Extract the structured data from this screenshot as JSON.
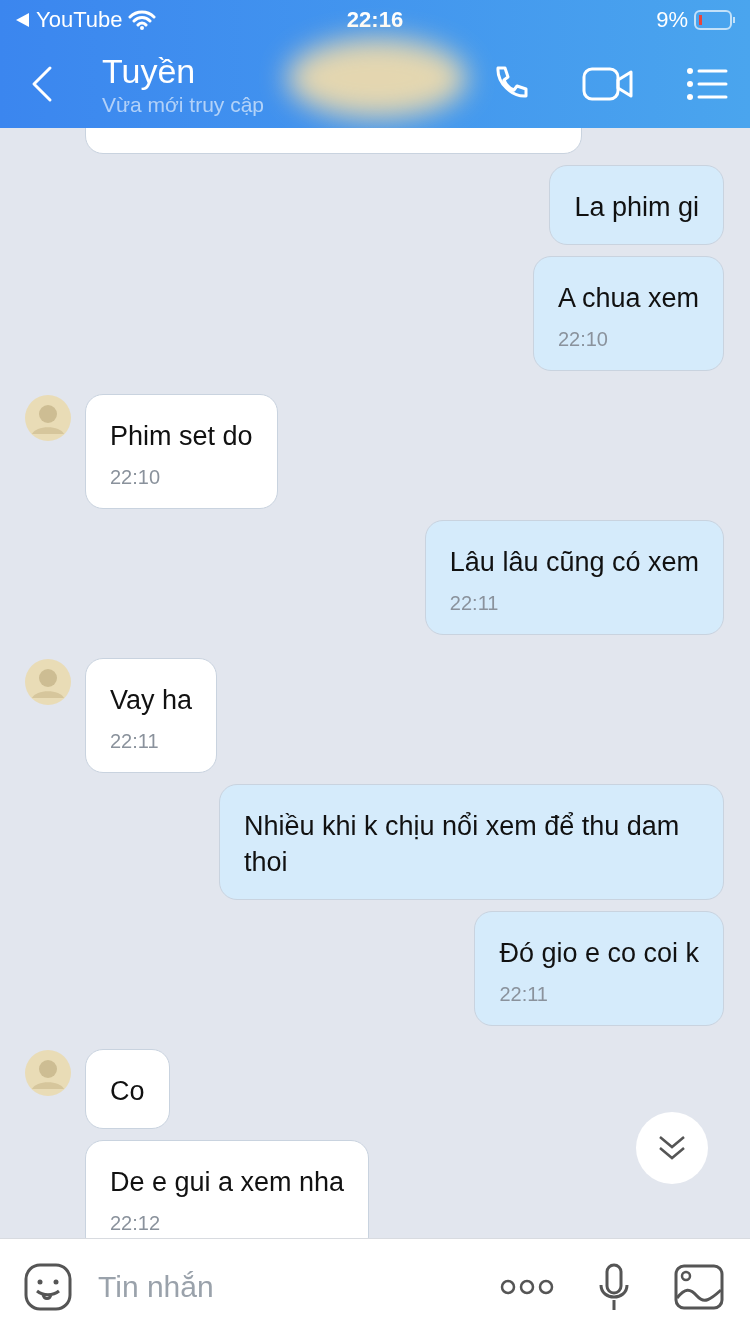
{
  "status_bar": {
    "app_back": "YouTube",
    "time": "22:16",
    "battery": "9%"
  },
  "header": {
    "name": "Tuyền",
    "subtitle": "Vừa mới truy cập"
  },
  "messages": [
    {
      "kind": "incoming"
    },
    {
      "kind": "outgoing",
      "text": "La phim gi"
    },
    {
      "kind": "outgoing",
      "text": "A chua xem",
      "time": "22:10"
    },
    {
      "kind": "incoming",
      "text": "Phim set do",
      "time": "22:10",
      "show_avatar": true
    },
    {
      "kind": "outgoing",
      "text": "Lâu lâu cũng có xem",
      "time": "22:11"
    },
    {
      "kind": "incoming",
      "text": "Vay ha",
      "time": "22:11",
      "show_avatar": true
    },
    {
      "kind": "outgoing",
      "text": "Nhiều khi k chịu nổi xem để thu dam thoi"
    },
    {
      "kind": "outgoing",
      "text": "Đó gio e co coi k",
      "time": "22:11"
    },
    {
      "kind": "incoming",
      "text": "Co",
      "show_avatar": true
    },
    {
      "kind": "incoming",
      "text": "De e gui a xem nha",
      "time": "22:12",
      "show_avatar": false
    }
  ],
  "composer": {
    "placeholder": "Tin nhắn"
  }
}
